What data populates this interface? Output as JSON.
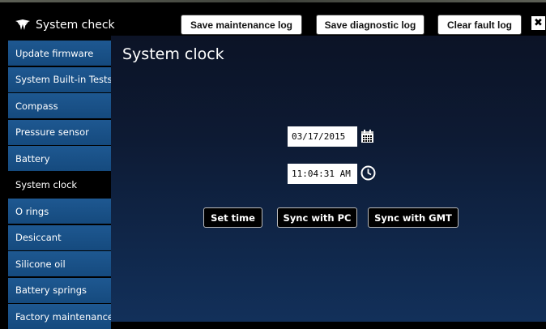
{
  "header": {
    "title": "System check",
    "save_maintenance_label": "Save maintenance log",
    "save_diagnostic_label": "Save diagnostic log",
    "clear_fault_label": "Clear fault log",
    "close_glyph": "✖"
  },
  "sidebar": {
    "items": [
      {
        "label": "Update firmware"
      },
      {
        "label": "System Built-in Tests"
      },
      {
        "label": "Compass"
      },
      {
        "label": "Pressure sensor"
      },
      {
        "label": "Battery"
      },
      {
        "label": "System clock"
      },
      {
        "label": "O rings"
      },
      {
        "label": "Desiccant"
      },
      {
        "label": "Silicone oil"
      },
      {
        "label": "Battery springs"
      },
      {
        "label": "Factory maintenance"
      }
    ],
    "selected": "System clock"
  },
  "main": {
    "title": "System clock",
    "date_value": "03/17/2015",
    "time_value": "11:04:31 AM",
    "set_time_label": "Set time",
    "sync_pc_label": "Sync with PC",
    "sync_gmt_label": "Sync with GMT"
  },
  "icons": [
    "logo-icon",
    "close-icon",
    "calendar-icon",
    "clock-icon"
  ],
  "colors": {
    "sidebar_item": "#1a5089",
    "selected_item": "#000000",
    "main_bg": "#0c1326",
    "accent": "#ffffff"
  }
}
